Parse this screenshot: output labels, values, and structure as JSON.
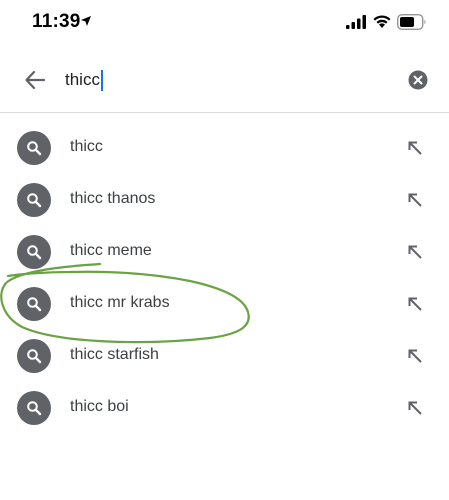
{
  "status_bar": {
    "time": "11:39",
    "location_icon": "location-arrow-icon",
    "signal_icon": "cellular-signal-icon",
    "wifi_icon": "wifi-icon",
    "battery_icon": "battery-icon"
  },
  "search": {
    "query": "thicc",
    "back_icon": "arrow-back-icon",
    "clear_icon": "clear-icon"
  },
  "suggestions": [
    {
      "label": "thicc"
    },
    {
      "label": "thicc thanos"
    },
    {
      "label": "thicc meme"
    },
    {
      "label": "thicc mr krabs"
    },
    {
      "label": "thicc starfish"
    },
    {
      "label": "thicc boi"
    }
  ],
  "colors": {
    "caret": "#1a73e8",
    "suggestion_icon_bg": "#5f6368",
    "annotation": "#6aa343"
  }
}
